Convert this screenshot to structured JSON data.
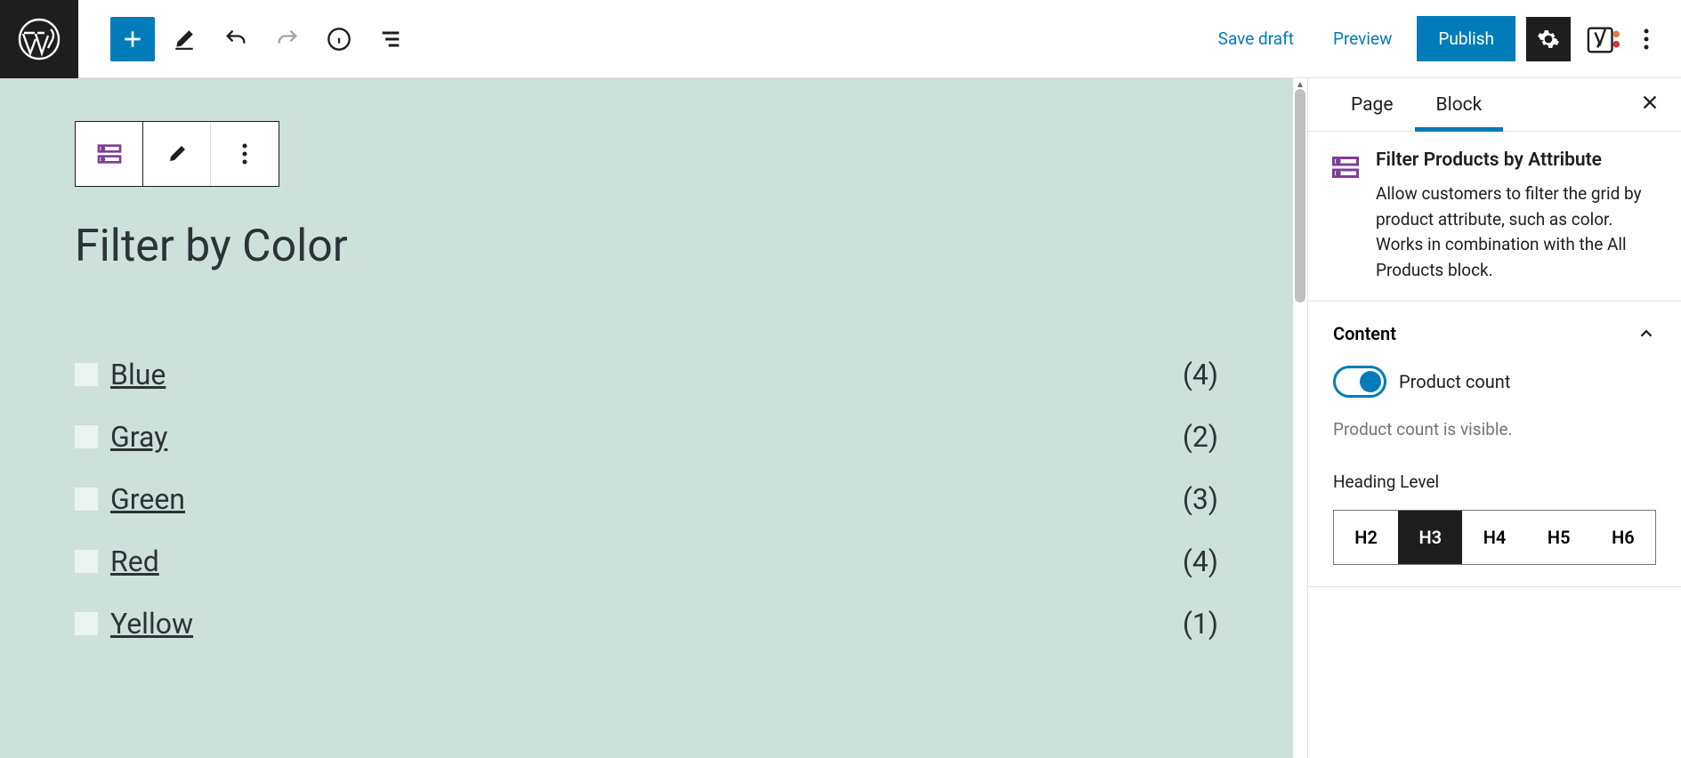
{
  "toolbar": {
    "save_draft": "Save draft",
    "preview": "Preview",
    "publish": "Publish"
  },
  "block": {
    "heading": "Filter by Color",
    "items": [
      {
        "label": "Blue",
        "count": "(4)"
      },
      {
        "label": "Gray",
        "count": "(2)"
      },
      {
        "label": "Green",
        "count": "(3)"
      },
      {
        "label": "Red",
        "count": "(4)"
      },
      {
        "label": "Yellow",
        "count": "(1)"
      }
    ]
  },
  "sidebar": {
    "tab_page": "Page",
    "tab_block": "Block",
    "block_title": "Filter Products by Attribute",
    "block_desc": "Allow customers to filter the grid by product attribute, such as color. Works in combination with the All Products block.",
    "content_panel": "Content",
    "product_count_label": "Product count",
    "product_count_helper": "Product count is visible.",
    "heading_level_label": "Heading Level",
    "heading_levels": [
      "H2",
      "H3",
      "H4",
      "H5",
      "H6"
    ]
  }
}
